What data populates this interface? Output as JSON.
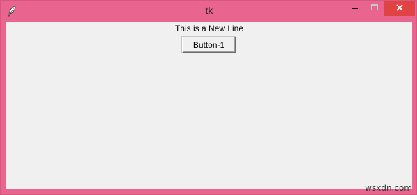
{
  "window": {
    "title": "tk",
    "app_icon": "feather-icon",
    "controls": {
      "minimize_icon": "minimize-icon",
      "maximize_icon": "maximize-icon",
      "close_icon": "close-icon"
    },
    "frame_color": "#e9648e",
    "close_button_color": "#e04343"
  },
  "content": {
    "label_text": "This is a New Line",
    "button_label": "Button-1",
    "background_color": "#f0f0f0"
  },
  "watermark": "wsxdn.com"
}
